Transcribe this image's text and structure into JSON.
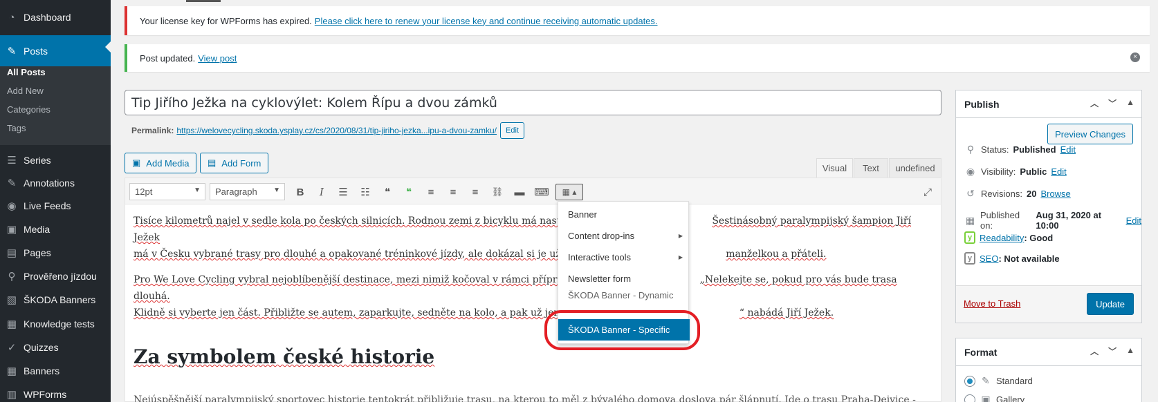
{
  "sidebar": {
    "items": [
      {
        "label": "Dashboard",
        "icon": "dashboard-icon",
        "glyph": "◔"
      },
      {
        "label": "Posts",
        "icon": "pin-icon",
        "glyph": "📌"
      },
      {
        "label": "Series",
        "icon": "list-icon",
        "glyph": "☰"
      },
      {
        "label": "Annotations",
        "icon": "annotation-icon",
        "glyph": "✎"
      },
      {
        "label": "Live Feeds",
        "icon": "rss-icon",
        "glyph": "◉"
      },
      {
        "label": "Media",
        "icon": "media-icon",
        "glyph": "▣"
      },
      {
        "label": "Pages",
        "icon": "pages-icon",
        "glyph": "▤"
      },
      {
        "label": "Prověřeno jízdou",
        "icon": "location-icon",
        "glyph": "⚲"
      },
      {
        "label": "ŠKODA Banners",
        "icon": "image-icon",
        "glyph": "▧"
      },
      {
        "label": "Knowledge tests",
        "icon": "grid-icon",
        "glyph": "▦"
      },
      {
        "label": "Quizzes",
        "icon": "check-icon",
        "glyph": "✓"
      },
      {
        "label": "Banners",
        "icon": "grid-icon",
        "glyph": "▦"
      },
      {
        "label": "WPForms",
        "icon": "form-icon",
        "glyph": "▥"
      }
    ],
    "submenu": [
      "All Posts",
      "Add New",
      "Categories",
      "Tags"
    ]
  },
  "notices": {
    "license_text": "Your license key for WPForms has expired.",
    "license_link": "Please click here to renew your license key and continue receiving automatic updates.",
    "updated_text": "Post updated.",
    "updated_link": "View post",
    "dismiss": "×"
  },
  "editor": {
    "title": "Tip Jiřího Ježka na cyklovýlet: Kolem Řípu a dvou zámků",
    "permalink_label": "Permalink:",
    "permalink_url": "https://welovecycling.skoda.ysplay.cz/cs/2020/08/31/tip-jiriho-jezka...ipu-a-dvou-zamku/",
    "permalink_edit": "Edit",
    "add_media": "Add Media",
    "add_form": "Add Form",
    "tabs": [
      "Visual",
      "Text",
      "undefined"
    ],
    "font_size": "12pt",
    "format": "Paragraph",
    "toolbar_icons": [
      "bold-icon",
      "italic-icon",
      "bullet-list-icon",
      "numbered-list-icon",
      "quote-icon",
      "green-quote-icon",
      "align-left-icon",
      "align-center-icon",
      "align-right-icon",
      "link-icon",
      "more-icon",
      "keyboard-icon",
      "shortcodes-icon",
      "fullscreen-icon"
    ],
    "toolbar_glyphs": [
      "B",
      "I",
      "☰",
      "☷",
      "❝",
      "❝",
      "≡",
      "≡",
      "≡",
      "🔗",
      "▬",
      "⌨",
      "▦ ▴",
      "⤢"
    ],
    "content": {
      "p1_a": "Tisíce kilometrů najel v sedle kola po českých silnicích. Rodnou zemi z bicyklu má nast",
      "p1_b": "Šestinásobný paralympijský šampion Jiří Ježek",
      "p1_c": "má v Česku vybrané trasy pro dlouhé a opakované tréninkové jízdy, ale dokázal si je uží",
      "p1_d": "manželkou a přáteli.",
      "p2_a": "Pro We Love Cycling vybral nejoblíbenější destinace, mezi nimiž kočoval v rámci příprav",
      "p2_b": "„Nelekejte se, pokud pro vás bude trasa dlouhá.",
      "p2_c": "Klidně si vyberte jen část. Přibližte se autem, zaparkujte, sedněte na kolo, a pak už jen p",
      "p2_d": "“ nabádá Jiří Ježek.",
      "heading": "Za symbolem české historie",
      "p3": "Nejúspěšnější paralympijský sportovec historie tentokrát přibližuje trasu, na kterou to měl z bývalého domova doslova pár šlápnutí. Jde o trasu Praha-Dejvice -"
    }
  },
  "dropdown": {
    "items": [
      "Banner",
      "Content drop-ins",
      "Interactive tools",
      "Newsletter form",
      "ŠKODA Banner - Dynamic",
      "ŠKODA Banner - Specific"
    ],
    "submenu_arrow": "▶"
  },
  "publish": {
    "title": "Publish",
    "preview": "Preview Changes",
    "status_label": "Status:",
    "status_value": "Published",
    "visibility_label": "Visibility:",
    "visibility_value": "Public",
    "revisions_label": "Revisions:",
    "revisions_value": "20",
    "revisions_link": "Browse",
    "published_label": "Published on:",
    "published_value": "Aug 31, 2020 at 10:00",
    "edit": "Edit",
    "readability_link": "Readability",
    "readability_value": ": Good",
    "seo_link": "SEO",
    "seo_value": ": Not available",
    "trash": "Move to Trash",
    "update": "Update"
  },
  "format": {
    "title": "Format",
    "options": [
      "Standard",
      "Gallery"
    ]
  },
  "colors": {
    "accent": "#0073aa",
    "highlight_ring": "#e31e24",
    "sidebar": "#23282d"
  }
}
